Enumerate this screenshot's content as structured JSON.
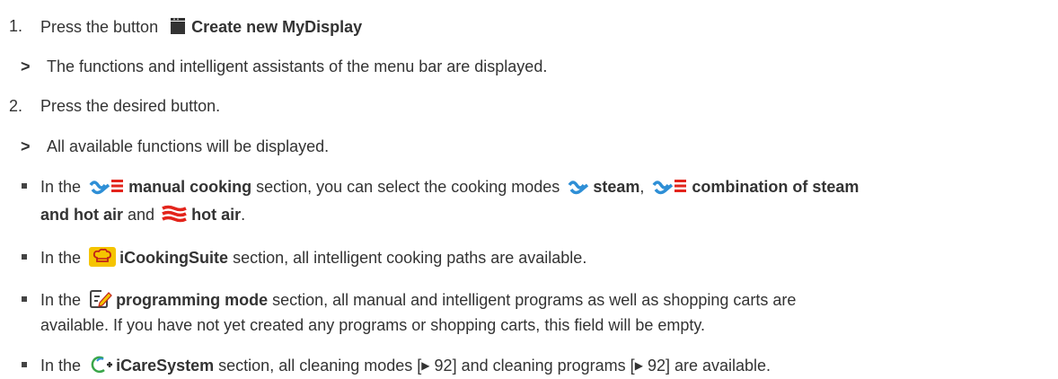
{
  "steps": [
    {
      "number": "1.",
      "prefix": "Press the button",
      "button_label": "Create new MyDisplay",
      "button_icon": "display-icon"
    },
    {
      "number": "2.",
      "text": "Press the desired button."
    }
  ],
  "results": [
    {
      "marker": ">",
      "text": "The functions and intelligent assistants of the menu bar are displayed."
    },
    {
      "marker": ">",
      "text": "All available functions will be displayed."
    }
  ],
  "bullets": {
    "manual": {
      "pre": "In the",
      "section": "manual cooking",
      "mid": "section, you can select the cooking modes",
      "mode1": "steam",
      "comma": ",",
      "mode2": "combination of steam",
      "mode2b": "and hot air",
      "and": "and",
      "mode3": "hot air",
      "end": "."
    },
    "icooking": {
      "pre": "In the",
      "section": "iCookingSuite",
      "post": "section, all intelligent cooking paths are available."
    },
    "programming": {
      "pre": "In the",
      "section": "programming mode",
      "post": "section, all manual and intelligent programs as well as shopping carts are",
      "line2": "available. If you have not yet created any programs or shopping carts, this field will be empty."
    },
    "icare": {
      "pre": "In the",
      "section": "iCareSystem",
      "mid1": "section, all cleaning modes [",
      "ref1": "92",
      "mid2": "] and cleaning programs [",
      "ref2": "92",
      "end": "] are available."
    }
  },
  "colors": {
    "text": "#333333",
    "steam_blue": "#2e8fd6",
    "hot_air_red": "#e3241b",
    "icooking_yellow": "#f5c400",
    "icare_green": "#3aa64a"
  }
}
